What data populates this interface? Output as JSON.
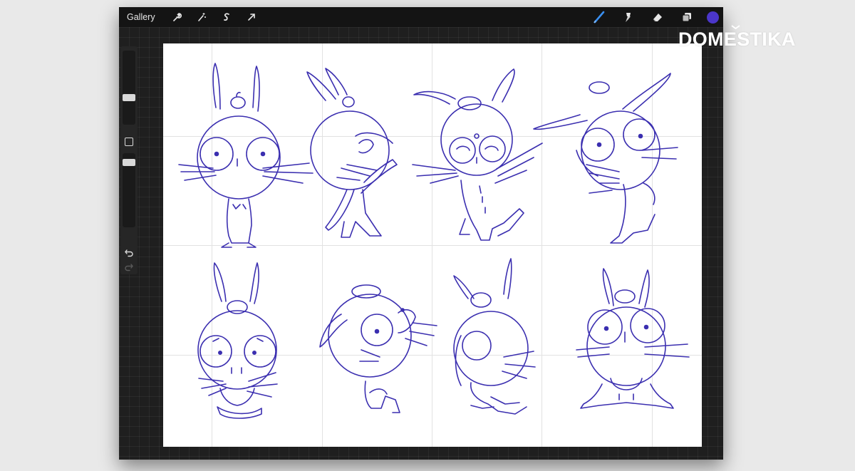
{
  "app": {
    "toolbar": {
      "gallery_label": "Gallery",
      "left_icons": [
        "wrench-icon",
        "magic-wand-icon",
        "selection-s-icon",
        "transform-arrow-icon"
      ],
      "right_icons": [
        "brush-icon",
        "smudge-icon",
        "eraser-icon",
        "layers-icon"
      ],
      "current_color": "#4b36c9"
    },
    "sidebar": {
      "icons": [
        "brush-size-slider",
        "modify-button",
        "opacity-slider",
        "undo-icon",
        "redo-icon"
      ]
    }
  },
  "watermark": {
    "text": "DOMESTIKA"
  },
  "artwork": {
    "subject": "bunny-character-pose-sketches",
    "grid_rows": 2,
    "grid_cols": 4,
    "stroke_color": "#3b2fb0"
  }
}
